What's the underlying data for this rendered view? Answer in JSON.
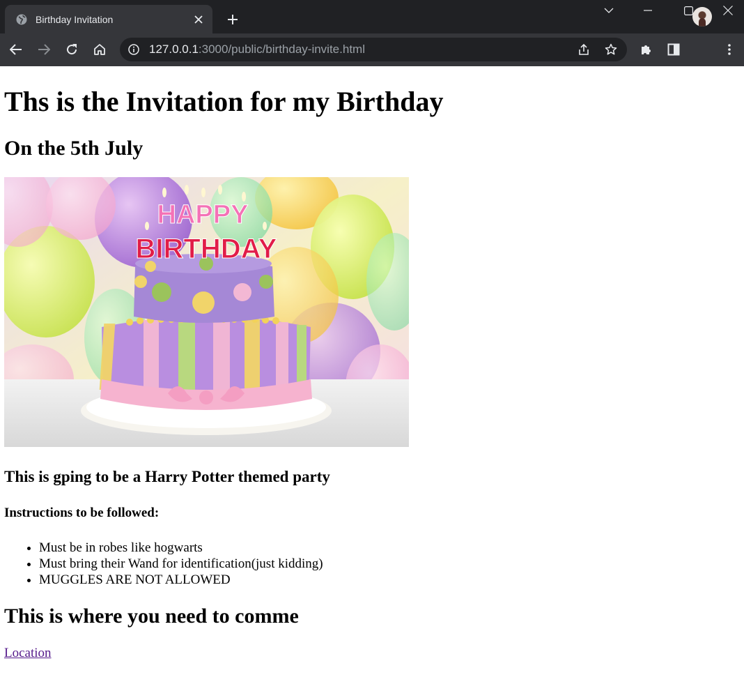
{
  "browser": {
    "tab_title": "Birthday Invitation",
    "url_host": "127.0.0.1",
    "url_rest": ":3000/public/birthday-invite.html",
    "icons": [
      "globe-icon",
      "close-icon",
      "plus-icon",
      "chevron-down-icon",
      "minimize-icon",
      "maximize-icon",
      "window-close-icon",
      "back-arrow-icon",
      "forward-arrow-icon",
      "reload-icon",
      "home-icon",
      "info-icon",
      "share-icon",
      "star-icon",
      "puzzle-icon",
      "side-panel-icon",
      "kebab-menu-icon"
    ]
  },
  "page": {
    "title": "Ths is the Invitation for my Birthday",
    "date": "On the 5th July",
    "image_text": {
      "line1": "HAPPY",
      "line2": "BIRTHDAY"
    },
    "theme": "This is gping to be a Harry Potter themed party",
    "instructions_heading": "Instructions to be followed:",
    "instructions": [
      "Must be in robes like hogwarts",
      "Must bring their Wand for identification(just kidding)",
      "MUGGLES ARE NOT ALLOWED"
    ],
    "where_heading": "This is where you need to comme",
    "location_link": "Location"
  }
}
